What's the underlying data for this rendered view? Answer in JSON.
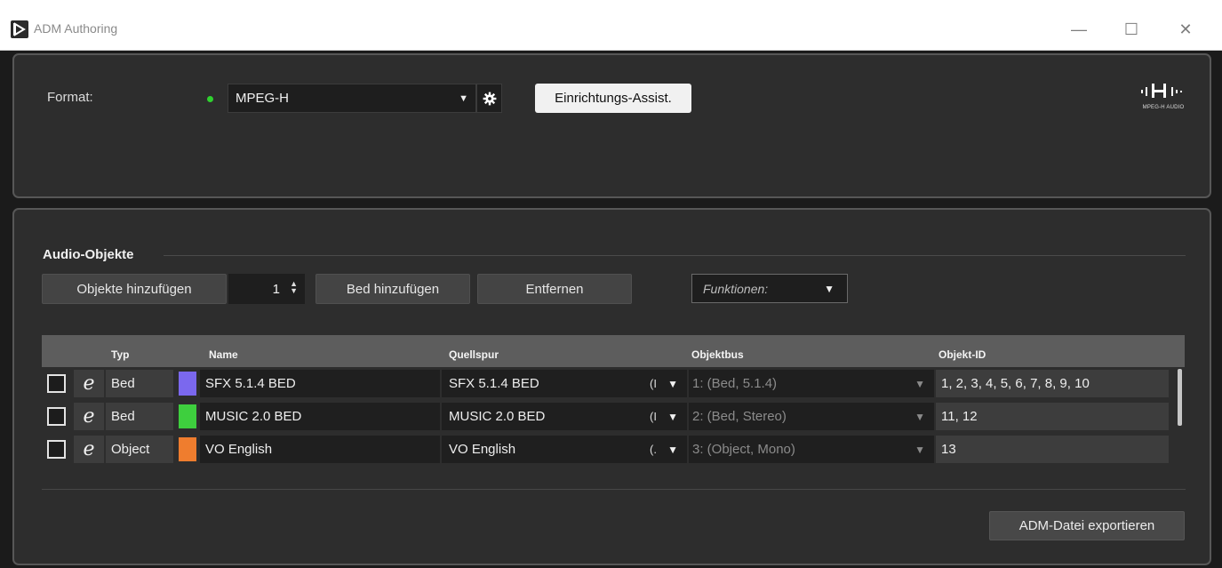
{
  "window": {
    "title": "ADM Authoring"
  },
  "format": {
    "label": "Format:",
    "selected": "MPEG-H",
    "setup_button": "Einrichtungs-Assist.",
    "logo_text": "MPEG-H AUDIO"
  },
  "audio_objects": {
    "title": "Audio-Objekte",
    "add_objects_label": "Objekte hinzufügen",
    "add_objects_count": "1",
    "add_bed_label": "Bed hinzufügen",
    "remove_label": "Entfernen",
    "functions_placeholder": "Funktionen:",
    "columns": [
      "Typ",
      "Name",
      "Quellspur",
      "Objektbus",
      "Objekt-ID"
    ],
    "rows": [
      {
        "type": "Bed",
        "name": "SFX 5.1.4 BED",
        "color": "#7b68ee",
        "source": "SFX 5.1.4 BED",
        "source_suffix": "(I",
        "bus": "1: (Bed, 5.1.4)",
        "ids": "1, 2, 3, 4, 5, 6, 7, 8, 9, 10"
      },
      {
        "type": "Bed",
        "name": "MUSIC 2.0 BED",
        "color": "#3ecf3e",
        "source": "MUSIC 2.0 BED",
        "source_suffix": "(I",
        "bus": "2: (Bed, Stereo)",
        "ids": "11, 12"
      },
      {
        "type": "Object",
        "name": "VO English",
        "color": "#ef7d2e",
        "source": "VO English",
        "source_suffix": "(.",
        "bus": "3: (Object, Mono)",
        "ids": "13"
      }
    ],
    "export_label": "ADM-Datei exportieren"
  }
}
